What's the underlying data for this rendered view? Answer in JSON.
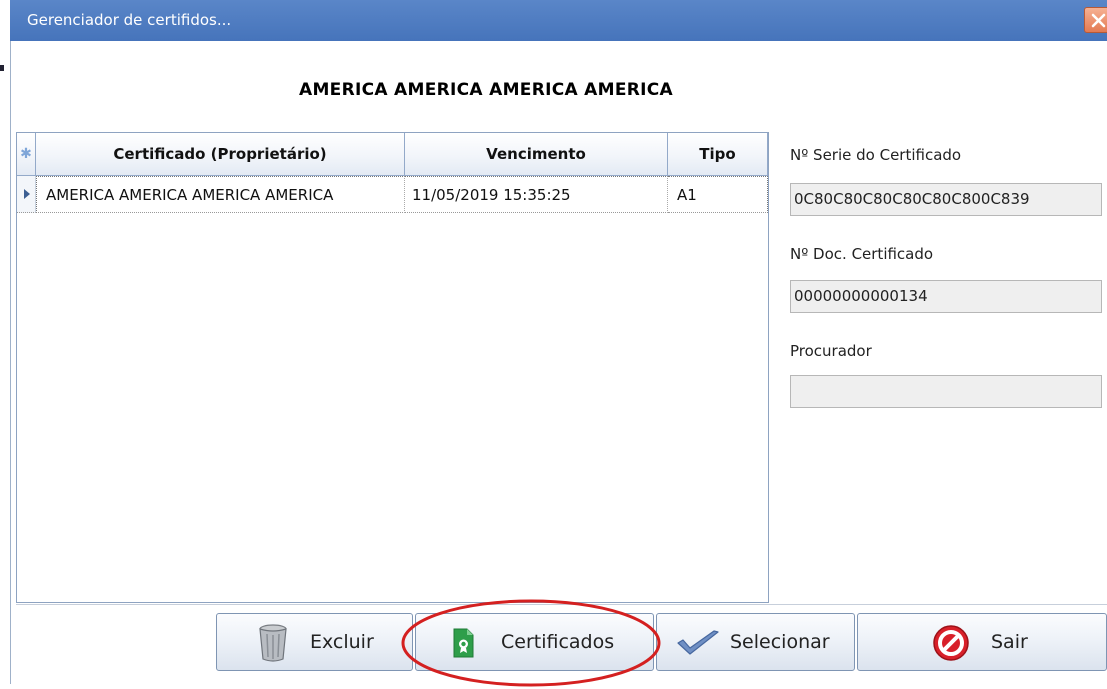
{
  "window": {
    "title": "Gerenciador de certifidos...",
    "header_label": "AMERICA AMERICA AMERICA AMERICA"
  },
  "grid": {
    "indicator_icon": "new-row-asterisk-icon",
    "columns": [
      "Certificado (Proprietário)",
      "Vencimento",
      "Tipo"
    ],
    "rows": [
      {
        "owner": "AMERICA  AMERICA  AMERICA  AMERICA",
        "expires": "11/05/2019 15:35:25",
        "type": "A1"
      }
    ]
  },
  "details": {
    "serial_label": "Nº Serie do Certificado",
    "serial_value": "0C80C80C80C80C80C800C839",
    "doc_label": "Nº Doc. Certificado",
    "doc_value": "00000000000134",
    "proxy_label": "Procurador",
    "proxy_value": ""
  },
  "buttons": {
    "delete": "Excluir",
    "certificates": "Certificados",
    "select": "Selecionar",
    "exit": "Sair"
  },
  "colors": {
    "titlebar": "#4674bb",
    "annotation": "#d42020",
    "certificate_icon": "#2e9e4a",
    "exit_icon": "#d8202a"
  }
}
